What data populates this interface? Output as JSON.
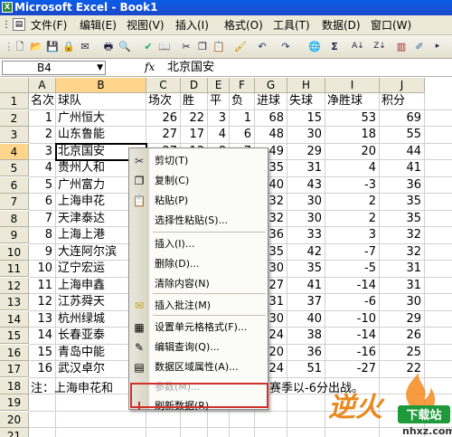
{
  "window": {
    "title": "Microsoft Excel - Book1"
  },
  "menu": [
    "文件(F)",
    "编辑(E)",
    "视图(V)",
    "插入(I)",
    "格式(O)",
    "工具(T)",
    "数据(D)",
    "窗口(W)"
  ],
  "toolbar": {
    "font_size": "14"
  },
  "formula_bar": {
    "name_box": "B4",
    "fx": "fx",
    "value": "北京国安"
  },
  "columns": [
    "A",
    "B",
    "C",
    "D",
    "E",
    "F",
    "G",
    "H",
    "I",
    "J"
  ],
  "rows": [
    "1",
    "2",
    "3",
    "4",
    "5",
    "6",
    "7",
    "8",
    "9",
    "10",
    "11",
    "12",
    "13",
    "14",
    "15",
    "16",
    "17",
    "18",
    "19",
    "20",
    "21"
  ],
  "header_row": {
    "a": "名次",
    "b": "球队",
    "c": "场次",
    "d": "胜",
    "e": "平",
    "f": "负",
    "g": "进球",
    "h": "失球",
    "i": "净胜球",
    "j": "积分"
  },
  "data": [
    {
      "a": "1",
      "b": "广州恒大",
      "c": "26",
      "d": "22",
      "e": "3",
      "f": "1",
      "g": "68",
      "h": "15",
      "i": "53",
      "j": "69"
    },
    {
      "a": "2",
      "b": "山东鲁能",
      "c": "27",
      "d": "17",
      "e": "4",
      "f": "6",
      "g": "48",
      "h": "30",
      "i": "18",
      "j": "55"
    },
    {
      "a": "3",
      "b": "北京国安",
      "c": "27",
      "d": "13",
      "e": "8",
      "f": "7",
      "g": "49",
      "h": "29",
      "i": "20",
      "j": "44"
    },
    {
      "a": "4",
      "b": "贵州人和",
      "c": "",
      "d": "",
      "e": "",
      "f": "",
      "g": "35",
      "h": "31",
      "i": "4",
      "j": "41"
    },
    {
      "a": "5",
      "b": "广州富力",
      "c": "",
      "d": "",
      "e": "",
      "f": "",
      "g": "40",
      "h": "43",
      "i": "-3",
      "j": "36"
    },
    {
      "a": "6",
      "b": "上海申花",
      "c": "",
      "d": "",
      "e": "",
      "f": "",
      "g": "32",
      "h": "30",
      "i": "2",
      "j": "35"
    },
    {
      "a": "7",
      "b": "天津泰达",
      "c": "",
      "d": "",
      "e": "",
      "f": "",
      "g": "32",
      "h": "30",
      "i": "2",
      "j": "35"
    },
    {
      "a": "8",
      "b": "上海上港",
      "c": "",
      "d": "",
      "e": "",
      "f": "",
      "g": "36",
      "h": "33",
      "i": "3",
      "j": "32"
    },
    {
      "a": "9",
      "b": "大连阿尔滨",
      "c": "",
      "d": "",
      "e": "",
      "f": "",
      "g": "35",
      "h": "42",
      "i": "-7",
      "j": "32"
    },
    {
      "a": "10",
      "b": "辽宁宏运",
      "c": "",
      "d": "",
      "e": "",
      "f": "",
      "g": "30",
      "h": "35",
      "i": "-5",
      "j": "31"
    },
    {
      "a": "11",
      "b": "上海申鑫",
      "c": "",
      "d": "",
      "e": "",
      "f": "",
      "g": "27",
      "h": "41",
      "i": "-14",
      "j": "31"
    },
    {
      "a": "12",
      "b": "江苏舜天",
      "c": "",
      "d": "",
      "e": "",
      "f": "",
      "g": "31",
      "h": "37",
      "i": "-6",
      "j": "30"
    },
    {
      "a": "13",
      "b": "杭州绿城",
      "c": "",
      "d": "",
      "e": "",
      "f": "",
      "g": "30",
      "h": "40",
      "i": "-10",
      "j": "29"
    },
    {
      "a": "14",
      "b": "长春亚泰",
      "c": "",
      "d": "",
      "e": "",
      "f": "",
      "g": "24",
      "h": "38",
      "i": "-14",
      "j": "26"
    },
    {
      "a": "15",
      "b": "青岛中能",
      "c": "",
      "d": "",
      "e": "",
      "f": "",
      "g": "20",
      "h": "36",
      "i": "-16",
      "j": "25"
    },
    {
      "a": "16",
      "b": "武汉卓尔",
      "c": "",
      "d": "",
      "e": "",
      "f": "",
      "g": "24",
      "h": "51",
      "i": "-27",
      "j": "22"
    }
  ],
  "note": {
    "left": "注：上海申花和",
    "right": "赛季以-6分出战。"
  },
  "context_menu": [
    {
      "label": "剪切(T)",
      "icon": "scissors-icon",
      "glyph": "✂"
    },
    {
      "label": "复制(C)",
      "icon": "copy-icon",
      "glyph": "❐"
    },
    {
      "label": "粘贴(P)",
      "icon": "paste-icon",
      "glyph": "📋"
    },
    {
      "label": "选择性粘贴(S)...",
      "icon": "",
      "glyph": ""
    },
    {
      "label": "插入(I)...",
      "icon": "",
      "glyph": ""
    },
    {
      "label": "删除(D)...",
      "icon": "",
      "glyph": ""
    },
    {
      "label": "清除内容(N)",
      "icon": "",
      "glyph": ""
    },
    {
      "label": "插入批注(M)",
      "icon": "comment-icon",
      "glyph": "✉"
    },
    {
      "label": "设置单元格格式(F)...",
      "icon": "format-cells-icon",
      "glyph": "▦"
    },
    {
      "label": "编辑查询(Q)...",
      "icon": "edit-query-icon",
      "glyph": "✎"
    },
    {
      "label": "数据区域属性(A)...",
      "icon": "range-properties-icon",
      "glyph": "▤"
    },
    {
      "label": "参数(M)...",
      "icon": "",
      "glyph": ""
    },
    {
      "label": "刷新数据(R)",
      "icon": "refresh-icon",
      "glyph": "!"
    }
  ],
  "watermark": {
    "brand": "逆火",
    "badge": "下载站",
    "url": "nhxz.com"
  },
  "colors": {
    "title": "#0a5de8",
    "highlight": "#d2302a",
    "selected_header": "#ffd58b"
  }
}
